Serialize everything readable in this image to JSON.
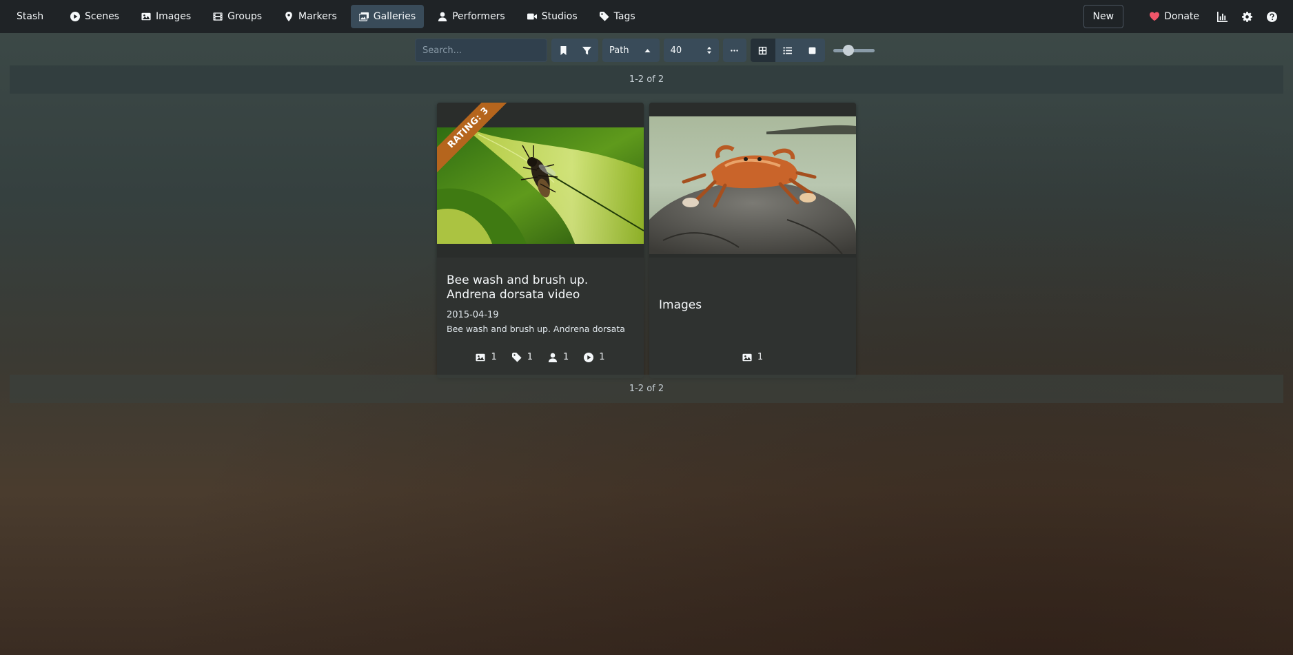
{
  "brand": "Stash",
  "nav": {
    "items": [
      {
        "label": "Scenes",
        "icon": "play-circle-icon"
      },
      {
        "label": "Images",
        "icon": "image-icon"
      },
      {
        "label": "Groups",
        "icon": "film-icon"
      },
      {
        "label": "Markers",
        "icon": "map-marker-icon"
      },
      {
        "label": "Galleries",
        "icon": "images-icon",
        "active": true
      },
      {
        "label": "Performers",
        "icon": "user-icon"
      },
      {
        "label": "Studios",
        "icon": "video-icon"
      },
      {
        "label": "Tags",
        "icon": "tag-icon"
      }
    ],
    "new_label": "New",
    "donate_label": "Donate"
  },
  "toolbar": {
    "search_placeholder": "Search...",
    "sort_label": "Path",
    "per_page": "40",
    "zoom_level": 0.33
  },
  "pagination": {
    "top": "1-2 of 2",
    "bottom": "1-2 of 2"
  },
  "cards": [
    {
      "rating": "RATING: 3",
      "title": "Bee wash and brush up. Andrena dorsata video",
      "date": "2015-04-19",
      "details": "Bee wash and brush up. Andrena dorsata",
      "counts": {
        "images": "1",
        "tags": "1",
        "performers": "1",
        "scenes": "1"
      }
    },
    {
      "title": "Images",
      "counts": {
        "images": "1"
      }
    }
  ],
  "colors": {
    "navbar": "#1f2326",
    "active_nav": "#394b59",
    "rating_ribbon": "#b5651d",
    "donate_heart": "#f0566a"
  }
}
